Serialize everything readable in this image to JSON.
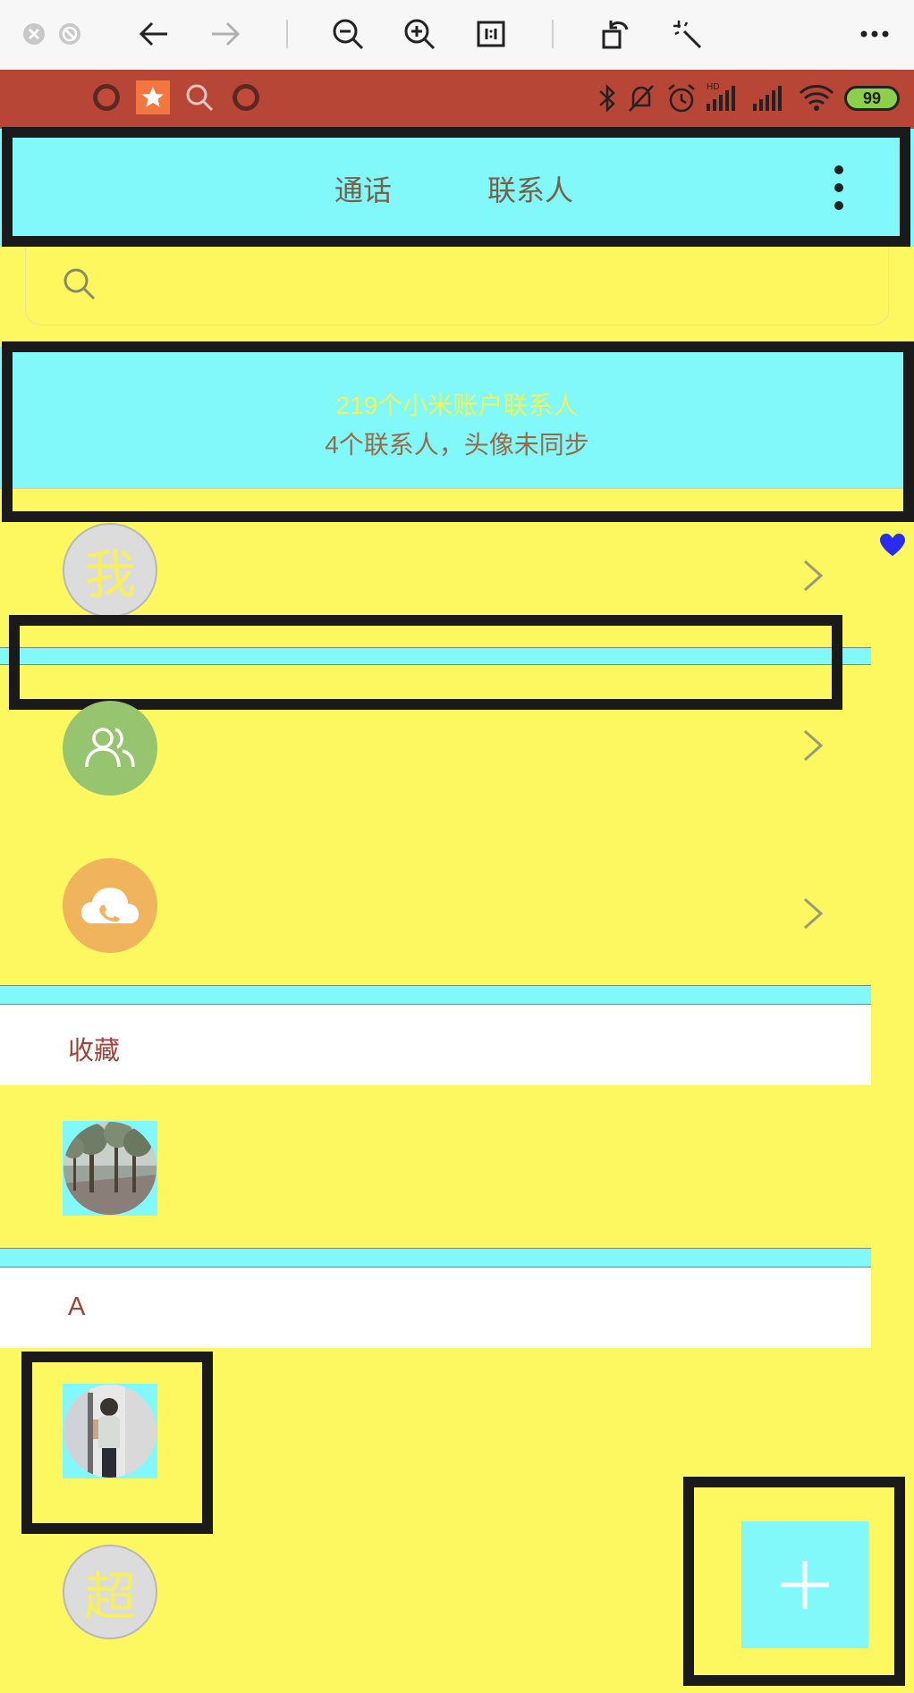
{
  "header": {
    "tabs": [
      "通话",
      "联系人"
    ]
  },
  "sync_banner": {
    "line1": "219个小米账户联系人",
    "line2": "4个联系人，头像未同步"
  },
  "me_row": {
    "avatar_text": "我"
  },
  "sections": {
    "favorites": "收藏",
    "a": "A"
  },
  "contact_row": {
    "avatar_text": "超"
  },
  "status": {
    "battery": "99"
  },
  "colors": {
    "background": "#fdf760",
    "cyan": "#81f8f9",
    "status_bar": "#b84637",
    "accent_text": "#a2433a"
  },
  "icons": {
    "toolbar": [
      "close-icon",
      "stop-icon",
      "back-arrow-icon",
      "forward-arrow-icon",
      "zoom-out-icon",
      "zoom-in-icon",
      "actual-size-icon",
      "rotate-icon",
      "magic-wand-icon",
      "more-icon"
    ],
    "status": [
      "app-icon",
      "star-icon",
      "search-icon",
      "app-icon",
      "bluetooth-icon",
      "mute-icon",
      "alarm-icon",
      "signal-icon",
      "wifi-icon",
      "battery-icon"
    ]
  }
}
